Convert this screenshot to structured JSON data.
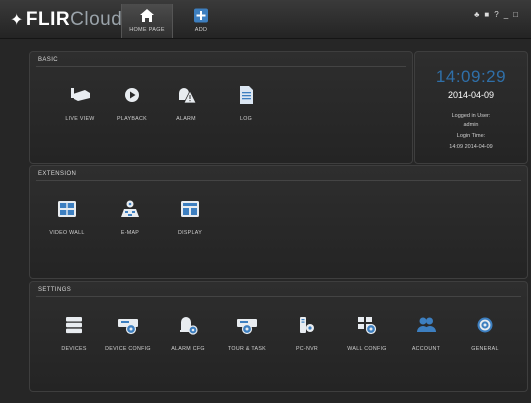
{
  "app": {
    "logo_mark": "✦",
    "logo_main": "FLIR",
    "logo_sub": "Cloud"
  },
  "nav": {
    "tabs": [
      {
        "label": "HOME PAGE",
        "icon": "home-icon",
        "active": true
      },
      {
        "label": "ADD",
        "icon": "add-icon",
        "active": false
      }
    ]
  },
  "window_controls": {
    "user": "♣",
    "lock": "■",
    "help": "?",
    "minimize": "_",
    "restore": "□"
  },
  "basic": {
    "title": "BASIC",
    "items": [
      {
        "label": "LIVE VIEW",
        "icon": "camera-icon"
      },
      {
        "label": "PLAYBACK",
        "icon": "play-icon"
      },
      {
        "label": "ALARM",
        "icon": "alarm-icon"
      },
      {
        "label": "LOG",
        "icon": "log-icon"
      }
    ]
  },
  "clock": {
    "time": "14:09:29",
    "date": "2014-04-09",
    "logged_in_label": "Logged in User:",
    "user": "admin",
    "login_time_label": "Login Time:",
    "login_time": "14:09 2014-04-09"
  },
  "extension": {
    "title": "EXTENSION",
    "items": [
      {
        "label": "VIDEO WALL",
        "icon": "video-wall-icon"
      },
      {
        "label": "E-MAP",
        "icon": "emap-icon"
      },
      {
        "label": "DISPLAY",
        "icon": "display-icon"
      }
    ]
  },
  "settings": {
    "title": "SETTINGS",
    "items": [
      {
        "label": "DEVICES",
        "icon": "devices-icon"
      },
      {
        "label": "DEVICE CONFIG",
        "icon": "device-config-icon"
      },
      {
        "label": "ALARM CFG",
        "icon": "alarm-cfg-icon"
      },
      {
        "label": "TOUR & TASK",
        "icon": "tour-task-icon"
      },
      {
        "label": "PC-NVR",
        "icon": "pc-nvr-icon"
      },
      {
        "label": "WALL CONFIG",
        "icon": "wall-config-icon"
      },
      {
        "label": "ACCOUNT",
        "icon": "account-icon"
      },
      {
        "label": "GENERAL",
        "icon": "general-icon"
      }
    ]
  },
  "colors": {
    "accent": "#2f6fa8",
    "icon_white": "#e8ecf0",
    "icon_blue": "#3d7fc0"
  }
}
